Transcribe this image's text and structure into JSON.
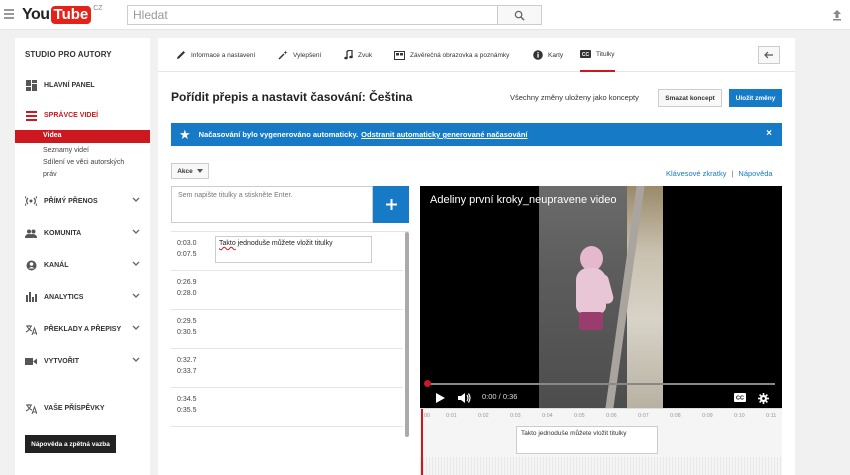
{
  "header": {
    "logo_you": "You",
    "logo_tube": "Tube",
    "logo_country": "CZ",
    "search_placeholder": "Hledat"
  },
  "sidebar": {
    "title": "STUDIO PRO AUTORY",
    "items": [
      {
        "label": "HLAVNÍ PANEL",
        "icon": "dashboard-icon"
      },
      {
        "label": "SPRÁVCE VIDEÍ",
        "icon": "video-manager-icon"
      },
      {
        "label": "PŘÍMÝ PŘENOS",
        "icon": "live-icon"
      },
      {
        "label": "KOMUNITA",
        "icon": "community-icon"
      },
      {
        "label": "KANÁL",
        "icon": "channel-icon"
      },
      {
        "label": "ANALYTICS",
        "icon": "analytics-icon"
      },
      {
        "label": "PŘEKLADY A PŘEPISY",
        "icon": "translate-icon"
      },
      {
        "label": "VYTVOŘIT",
        "icon": "create-icon"
      },
      {
        "label": "VAŠE PŘÍSPĚVKY",
        "icon": "contributions-icon"
      }
    ],
    "subitems": [
      "Videa",
      "Seznamy videí",
      "Sdílení ve věci autorských",
      "práv"
    ],
    "help_button": "Nápověda a zpětná vazba"
  },
  "tabs": [
    {
      "label": "Informace a nastavení",
      "icon": "pencil-icon"
    },
    {
      "label": "Vylepšení",
      "icon": "magic-wand-icon"
    },
    {
      "label": "Zvuk",
      "icon": "music-note-icon"
    },
    {
      "label": "Závěrečná obrazovka a poznámky",
      "icon": "end-screen-icon"
    },
    {
      "label": "Karty",
      "icon": "info-icon"
    },
    {
      "label": "Titulky",
      "icon": "cc-icon"
    }
  ],
  "editor": {
    "title": "Pořídit přepis a nastavit časování: Čeština",
    "saved_status": "Všechny změny uloženy jako koncepty",
    "discard_label": "Smazat koncept",
    "save_label": "Uložit změny",
    "banner_text": "Načasování bylo vygenerováno automaticky.",
    "banner_link": "Odstranit automaticky generované načasování",
    "actions_label": "Akce",
    "shortcuts_link": "Klávesové zkratky",
    "help_link": "Nápověda",
    "caption_placeholder": "Sem napište titulky a stiskněte Enter."
  },
  "captions": [
    {
      "start": "0:03.0",
      "end": "0:07.5",
      "text": "Takto jednoduše můžete vložit titulky"
    },
    {
      "start": "0:26.9",
      "end": "0:28.0",
      "text": ""
    },
    {
      "start": "0:29.5",
      "end": "0:30.5",
      "text": ""
    },
    {
      "start": "0:32.7",
      "end": "0:33.7",
      "text": ""
    },
    {
      "start": "0:34.5",
      "end": "0:35.5",
      "text": ""
    }
  ],
  "video": {
    "title": "Adeliny první kroky_neupravene video",
    "time": "0:00 / 0:36",
    "progress": 0
  },
  "timeline": {
    "ticks": [
      "00",
      "0:01",
      "0:02",
      "0:03",
      "0:04",
      "0:05",
      "0:06",
      "0:07",
      "0:08",
      "0:09",
      "0:10",
      "0:11"
    ],
    "caption_text": "Takto jednoduše můžete vložit titulky"
  },
  "colors": {
    "brand_red": "#cc181e",
    "accent_blue": "#167ac6"
  }
}
